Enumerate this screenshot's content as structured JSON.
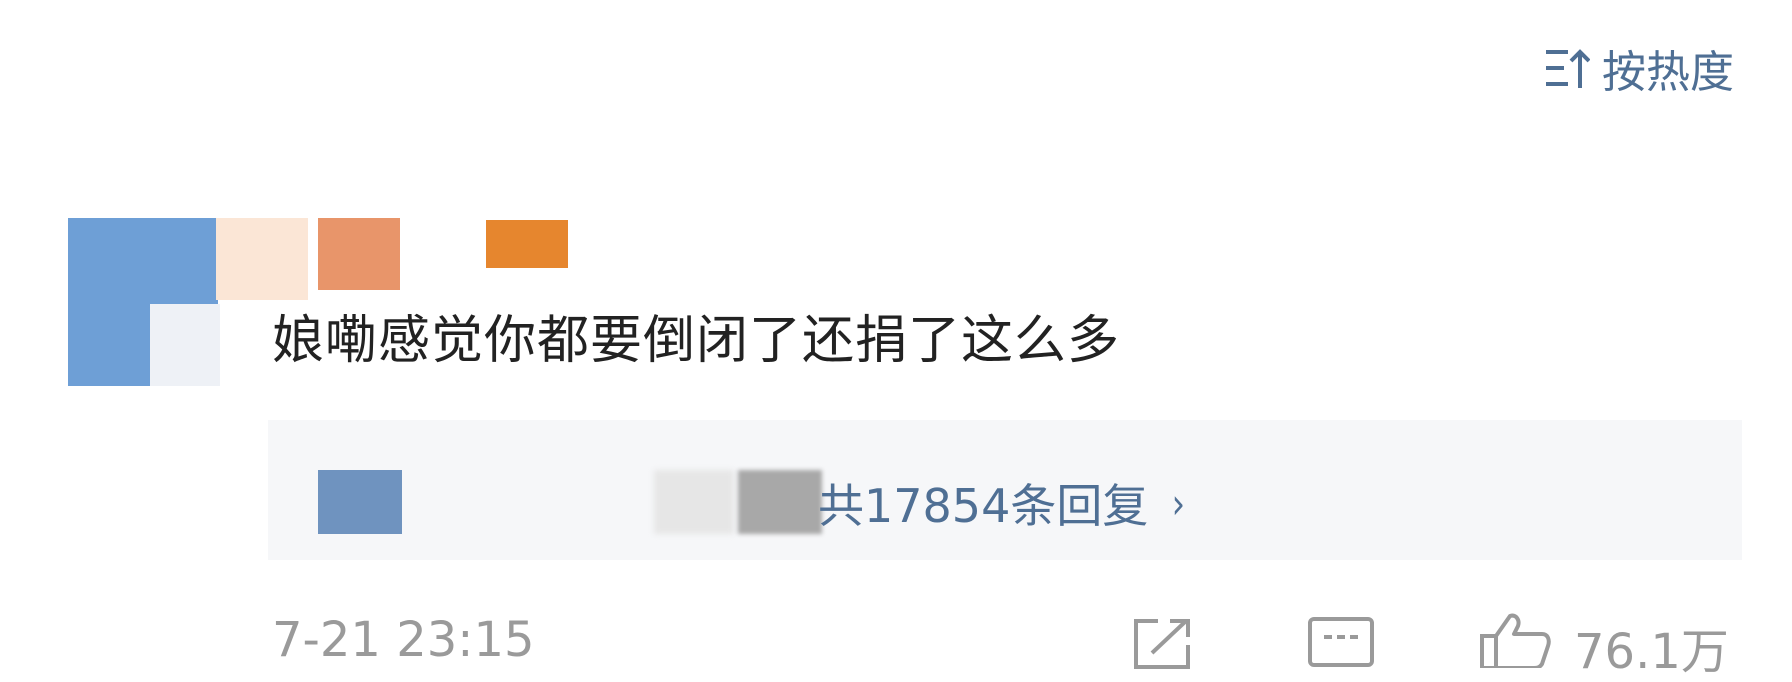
{
  "sort": {
    "label": "按热度",
    "icon": "sort-up-icon"
  },
  "comment": {
    "text": "娘嘞感觉你都要倒闭了还捐了这么多",
    "avatar_colors": [
      "#6e9fd6",
      "#fbe6d6",
      "#e8956a",
      "#e6862e"
    ]
  },
  "replies": {
    "link_text": "共17854条回复",
    "chevron": "›"
  },
  "footer": {
    "timestamp": "7-21 23:15",
    "like_count": "76.1万"
  },
  "colors": {
    "link": "#4f6f94",
    "muted": "#9a9a9a",
    "text": "#222222",
    "reply_bg": "#f6f7f9"
  }
}
